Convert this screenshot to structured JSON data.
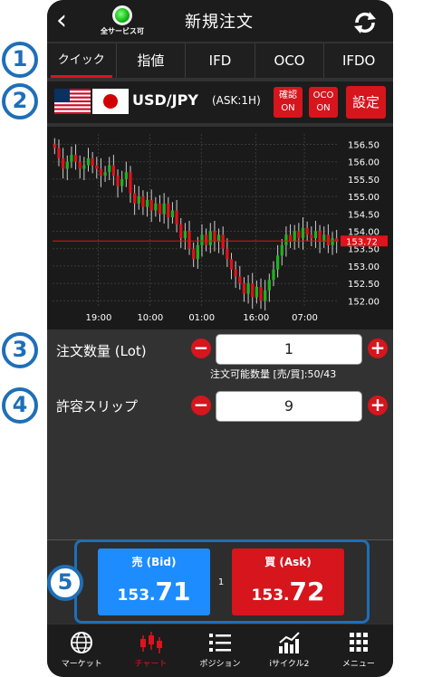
{
  "header": {
    "title": "新規注文",
    "status_text": "全サービス可"
  },
  "tabs": [
    {
      "label": "クイック",
      "active": true
    },
    {
      "label": "指値"
    },
    {
      "label": "IFD"
    },
    {
      "label": "OCO"
    },
    {
      "label": "IFDO"
    }
  ],
  "pair": {
    "symbol": "USD/JPY",
    "ask_info": "(ASK:1H)",
    "confirm_line1": "確認",
    "confirm_line2": "ON",
    "oco_line1": "OCO",
    "oco_line2": "ON",
    "settings": "設定"
  },
  "chart_data": {
    "type": "candlestick",
    "y_ticks": [
      "156.50",
      "156.00",
      "155.50",
      "155.00",
      "154.50",
      "154.00",
      "153.50",
      "153.00",
      "152.50",
      "152.00"
    ],
    "x_ticks": [
      "19:00",
      "10:00",
      "01:00",
      "16:00",
      "07:00"
    ],
    "current_price": "153.72",
    "ylim": [
      151.8,
      156.8
    ],
    "close": [
      156.4,
      156.1,
      155.8,
      156.0,
      156.2,
      156.0,
      155.8,
      155.9,
      156.1,
      155.9,
      155.8,
      155.6,
      155.7,
      155.9,
      155.6,
      155.3,
      155.5,
      155.7,
      155.1,
      154.8,
      155.0,
      154.7,
      154.9,
      154.6,
      154.8,
      154.5,
      154.8,
      154.4,
      154.6,
      154.2,
      153.8,
      154.0,
      153.5,
      153.2,
      153.6,
      153.9,
      153.6,
      154.0,
      153.7,
      153.9,
      153.5,
      153.2,
      152.9,
      152.7,
      152.5,
      152.2,
      152.5,
      152.1,
      152.4,
      152.0,
      152.3,
      152.6,
      152.9,
      153.3,
      153.6,
      153.9,
      153.7,
      154.0,
      153.8,
      154.1,
      153.9,
      153.8,
      154.0,
      153.7,
      153.9,
      153.6,
      153.8,
      153.7
    ]
  },
  "quantity": {
    "label": "注文数量 (Lot)",
    "value": "1",
    "available": "注文可能数量 [売/買]:50/43"
  },
  "slippage": {
    "label": "許容スリップ",
    "value": "9"
  },
  "bid": {
    "label": "売 (Bid)",
    "price_small": "153.",
    "price_big": "71"
  },
  "ask": {
    "label": "買 (Ask)",
    "price_small": "153.",
    "price_big": "72"
  },
  "spread": "1",
  "bottom_nav": [
    {
      "label": "マーケット"
    },
    {
      "label": "チャート",
      "active": true
    },
    {
      "label": "ポジション"
    },
    {
      "label": "iサイクル2"
    },
    {
      "label": "メニュー"
    }
  ],
  "annotations": [
    "1",
    "2",
    "3",
    "4",
    "5"
  ]
}
